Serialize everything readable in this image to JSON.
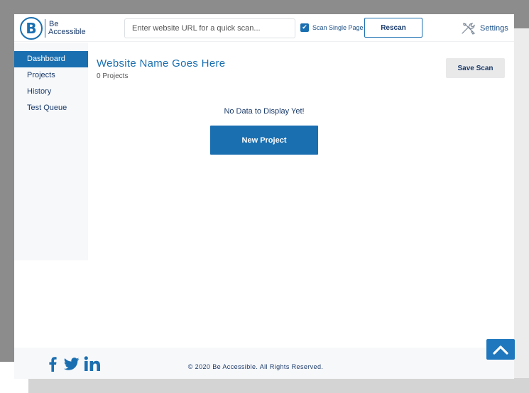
{
  "header": {
    "logo": {
      "line1": "Be",
      "line2": "Accessible",
      "mark": "B"
    },
    "url_placeholder": "Enter website URL for a quick scan...",
    "scan_single_page": {
      "label": "Scan Single Page",
      "checked": true
    },
    "rescan_label": "Rescan",
    "settings_label": "Settings",
    "settings_icon": "wrench-screwdriver-icon"
  },
  "sidebar": {
    "items": [
      {
        "label": "Dashboard",
        "active": true
      },
      {
        "label": "Projects",
        "active": false
      },
      {
        "label": "History",
        "active": false
      },
      {
        "label": "Test Queue",
        "active": false
      }
    ]
  },
  "main": {
    "title": "Website Name Goes Here",
    "project_count": "0 Projects",
    "save_scan_label": "Save Scan",
    "empty_message": "No Data to Display Yet!",
    "new_project_label": "New Project"
  },
  "footer": {
    "social": [
      "facebook-icon",
      "twitter-icon",
      "linkedin-icon"
    ],
    "copyright": "© 2020 Be Accessible. All Rights Reserved."
  },
  "colors": {
    "brand": "#1a6fb0",
    "text_dark": "#1a3a6a",
    "sidebar_bg": "#f6f8fa",
    "backdrop": "#8c8c8c"
  }
}
